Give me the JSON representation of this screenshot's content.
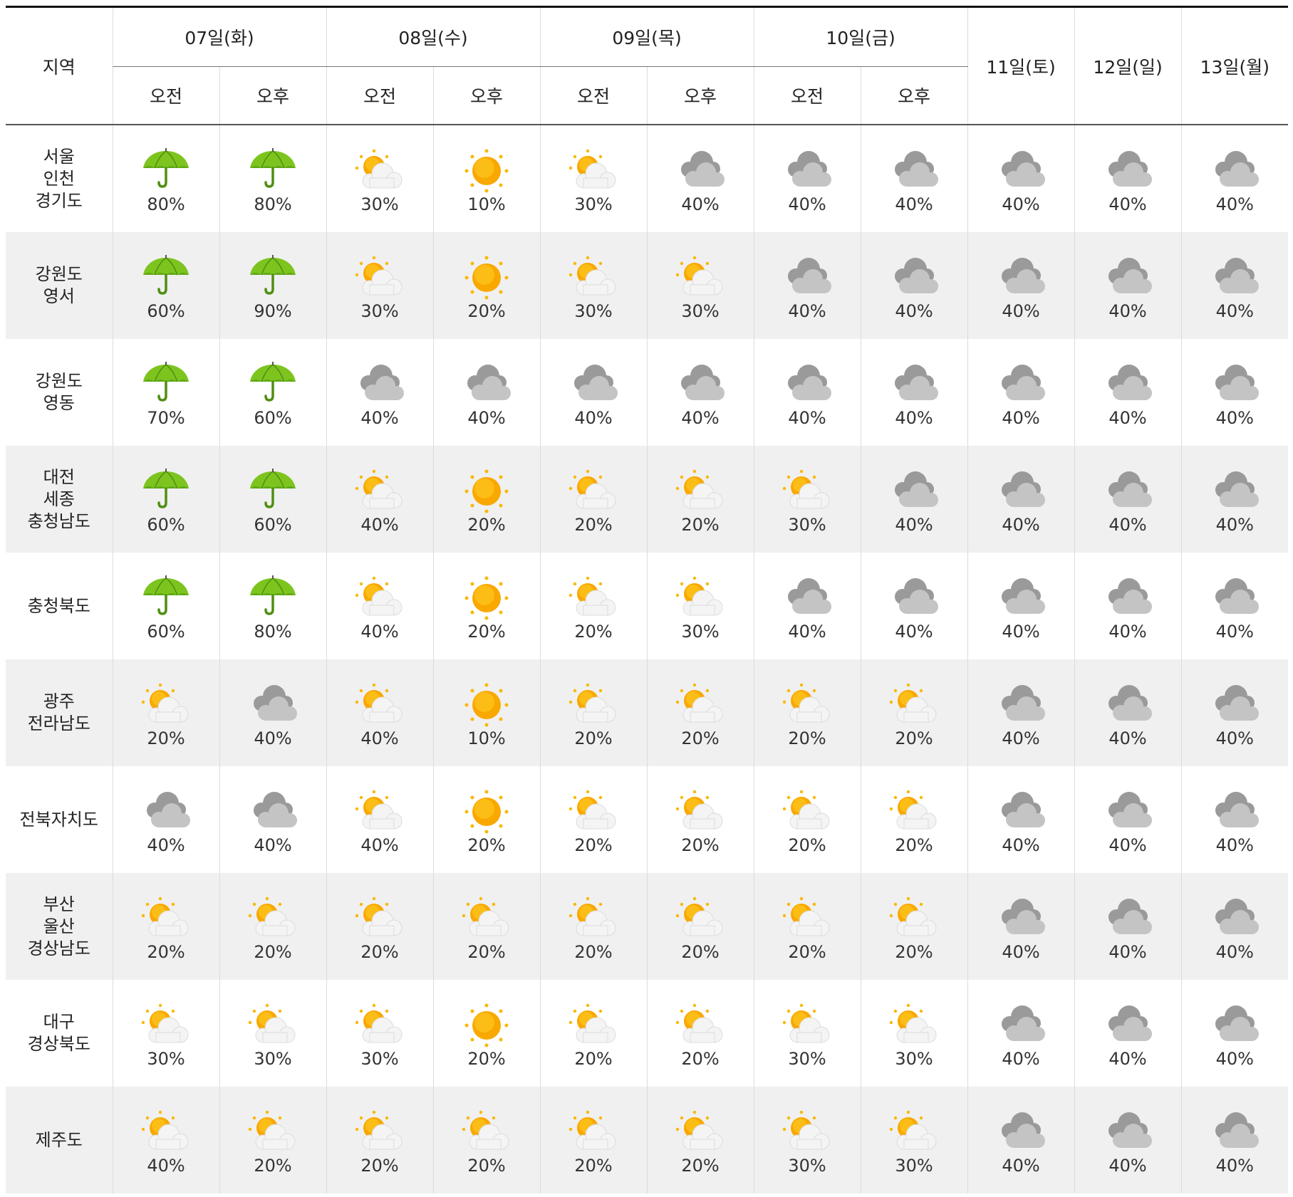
{
  "header": {
    "region_label": "지역",
    "days": [
      {
        "label": "07일(화)",
        "split": true
      },
      {
        "label": "08일(수)",
        "split": true
      },
      {
        "label": "09일(목)",
        "split": true
      },
      {
        "label": "10일(금)",
        "split": true
      },
      {
        "label": "11일(토)",
        "split": false
      },
      {
        "label": "12일(일)",
        "split": false
      },
      {
        "label": "13일(월)",
        "split": false
      }
    ],
    "am_label": "오전",
    "pm_label": "오후"
  },
  "legend_icons": {
    "rain": "umbrella-icon",
    "sunny": "sun-icon",
    "partly": "sun-cloud-icon",
    "cloudy": "cloud-icon"
  },
  "colors": {
    "umbrella": "#7dc41f",
    "sun": "#f9a800",
    "cloud": "#b8b8b8",
    "row_alt": "#f0f0f0"
  },
  "rows": [
    {
      "region": "서울\n인천\n경기도",
      "cells": [
        {
          "icon": "rain",
          "pct": "80%"
        },
        {
          "icon": "rain",
          "pct": "80%"
        },
        {
          "icon": "partly",
          "pct": "30%"
        },
        {
          "icon": "sunny",
          "pct": "10%"
        },
        {
          "icon": "partly",
          "pct": "30%"
        },
        {
          "icon": "cloudy",
          "pct": "40%"
        },
        {
          "icon": "cloudy",
          "pct": "40%"
        },
        {
          "icon": "cloudy",
          "pct": "40%"
        },
        {
          "icon": "cloudy",
          "pct": "40%"
        },
        {
          "icon": "cloudy",
          "pct": "40%"
        },
        {
          "icon": "cloudy",
          "pct": "40%"
        }
      ]
    },
    {
      "region": "강원도\n영서",
      "cells": [
        {
          "icon": "rain",
          "pct": "60%"
        },
        {
          "icon": "rain",
          "pct": "90%"
        },
        {
          "icon": "partly",
          "pct": "30%"
        },
        {
          "icon": "sunny",
          "pct": "20%"
        },
        {
          "icon": "partly",
          "pct": "30%"
        },
        {
          "icon": "partly",
          "pct": "30%"
        },
        {
          "icon": "cloudy",
          "pct": "40%"
        },
        {
          "icon": "cloudy",
          "pct": "40%"
        },
        {
          "icon": "cloudy",
          "pct": "40%"
        },
        {
          "icon": "cloudy",
          "pct": "40%"
        },
        {
          "icon": "cloudy",
          "pct": "40%"
        }
      ]
    },
    {
      "region": "강원도\n영동",
      "cells": [
        {
          "icon": "rain",
          "pct": "70%"
        },
        {
          "icon": "rain",
          "pct": "60%"
        },
        {
          "icon": "cloudy",
          "pct": "40%"
        },
        {
          "icon": "cloudy",
          "pct": "40%"
        },
        {
          "icon": "cloudy",
          "pct": "40%"
        },
        {
          "icon": "cloudy",
          "pct": "40%"
        },
        {
          "icon": "cloudy",
          "pct": "40%"
        },
        {
          "icon": "cloudy",
          "pct": "40%"
        },
        {
          "icon": "cloudy",
          "pct": "40%"
        },
        {
          "icon": "cloudy",
          "pct": "40%"
        },
        {
          "icon": "cloudy",
          "pct": "40%"
        }
      ]
    },
    {
      "region": "대전\n세종\n충청남도",
      "cells": [
        {
          "icon": "rain",
          "pct": "60%"
        },
        {
          "icon": "rain",
          "pct": "60%"
        },
        {
          "icon": "partly",
          "pct": "40%"
        },
        {
          "icon": "sunny",
          "pct": "20%"
        },
        {
          "icon": "partly",
          "pct": "20%"
        },
        {
          "icon": "partly",
          "pct": "20%"
        },
        {
          "icon": "partly",
          "pct": "30%"
        },
        {
          "icon": "cloudy",
          "pct": "40%"
        },
        {
          "icon": "cloudy",
          "pct": "40%"
        },
        {
          "icon": "cloudy",
          "pct": "40%"
        },
        {
          "icon": "cloudy",
          "pct": "40%"
        }
      ]
    },
    {
      "region": "충청북도",
      "cells": [
        {
          "icon": "rain",
          "pct": "60%"
        },
        {
          "icon": "rain",
          "pct": "80%"
        },
        {
          "icon": "partly",
          "pct": "40%"
        },
        {
          "icon": "sunny",
          "pct": "20%"
        },
        {
          "icon": "partly",
          "pct": "20%"
        },
        {
          "icon": "partly",
          "pct": "30%"
        },
        {
          "icon": "cloudy",
          "pct": "40%"
        },
        {
          "icon": "cloudy",
          "pct": "40%"
        },
        {
          "icon": "cloudy",
          "pct": "40%"
        },
        {
          "icon": "cloudy",
          "pct": "40%"
        },
        {
          "icon": "cloudy",
          "pct": "40%"
        }
      ]
    },
    {
      "region": "광주\n전라남도",
      "cells": [
        {
          "icon": "partly",
          "pct": "20%"
        },
        {
          "icon": "cloudy",
          "pct": "40%"
        },
        {
          "icon": "partly",
          "pct": "40%"
        },
        {
          "icon": "sunny",
          "pct": "10%"
        },
        {
          "icon": "partly",
          "pct": "20%"
        },
        {
          "icon": "partly",
          "pct": "20%"
        },
        {
          "icon": "partly",
          "pct": "20%"
        },
        {
          "icon": "partly",
          "pct": "20%"
        },
        {
          "icon": "cloudy",
          "pct": "40%"
        },
        {
          "icon": "cloudy",
          "pct": "40%"
        },
        {
          "icon": "cloudy",
          "pct": "40%"
        }
      ]
    },
    {
      "region": "전북자치도",
      "cells": [
        {
          "icon": "cloudy",
          "pct": "40%"
        },
        {
          "icon": "cloudy",
          "pct": "40%"
        },
        {
          "icon": "partly",
          "pct": "40%"
        },
        {
          "icon": "sunny",
          "pct": "20%"
        },
        {
          "icon": "partly",
          "pct": "20%"
        },
        {
          "icon": "partly",
          "pct": "20%"
        },
        {
          "icon": "partly",
          "pct": "20%"
        },
        {
          "icon": "partly",
          "pct": "20%"
        },
        {
          "icon": "cloudy",
          "pct": "40%"
        },
        {
          "icon": "cloudy",
          "pct": "40%"
        },
        {
          "icon": "cloudy",
          "pct": "40%"
        }
      ]
    },
    {
      "region": "부산\n울산\n경상남도",
      "cells": [
        {
          "icon": "partly",
          "pct": "20%"
        },
        {
          "icon": "partly",
          "pct": "20%"
        },
        {
          "icon": "partly",
          "pct": "20%"
        },
        {
          "icon": "partly",
          "pct": "20%"
        },
        {
          "icon": "partly",
          "pct": "20%"
        },
        {
          "icon": "partly",
          "pct": "20%"
        },
        {
          "icon": "partly",
          "pct": "20%"
        },
        {
          "icon": "partly",
          "pct": "20%"
        },
        {
          "icon": "cloudy",
          "pct": "40%"
        },
        {
          "icon": "cloudy",
          "pct": "40%"
        },
        {
          "icon": "cloudy",
          "pct": "40%"
        }
      ]
    },
    {
      "region": "대구\n경상북도",
      "cells": [
        {
          "icon": "partly",
          "pct": "30%"
        },
        {
          "icon": "partly",
          "pct": "30%"
        },
        {
          "icon": "partly",
          "pct": "30%"
        },
        {
          "icon": "sunny",
          "pct": "20%"
        },
        {
          "icon": "partly",
          "pct": "20%"
        },
        {
          "icon": "partly",
          "pct": "20%"
        },
        {
          "icon": "partly",
          "pct": "30%"
        },
        {
          "icon": "partly",
          "pct": "30%"
        },
        {
          "icon": "cloudy",
          "pct": "40%"
        },
        {
          "icon": "cloudy",
          "pct": "40%"
        },
        {
          "icon": "cloudy",
          "pct": "40%"
        }
      ]
    },
    {
      "region": "제주도",
      "cells": [
        {
          "icon": "partly",
          "pct": "40%"
        },
        {
          "icon": "partly",
          "pct": "20%"
        },
        {
          "icon": "partly",
          "pct": "20%"
        },
        {
          "icon": "partly",
          "pct": "20%"
        },
        {
          "icon": "partly",
          "pct": "20%"
        },
        {
          "icon": "partly",
          "pct": "20%"
        },
        {
          "icon": "partly",
          "pct": "30%"
        },
        {
          "icon": "partly",
          "pct": "30%"
        },
        {
          "icon": "cloudy",
          "pct": "40%"
        },
        {
          "icon": "cloudy",
          "pct": "40%"
        },
        {
          "icon": "cloudy",
          "pct": "40%"
        }
      ]
    }
  ]
}
